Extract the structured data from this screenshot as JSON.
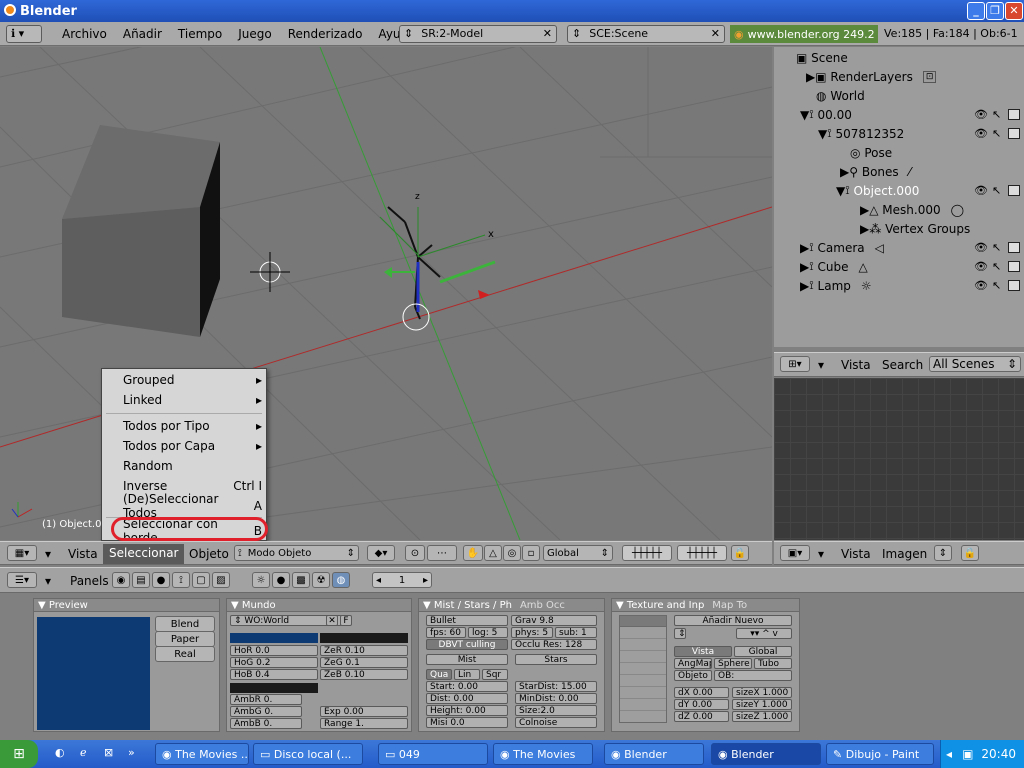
{
  "window": {
    "title": "Blender"
  },
  "menubar": {
    "items": [
      "Archivo",
      "Añadir",
      "Tiempo",
      "Juego",
      "Renderizado",
      "Ayuda"
    ],
    "screen": "SR:2-Model",
    "scene": "SCE:Scene",
    "version": "www.blender.org 249.2",
    "stats": "Ve:185 | Fa:184 | Ob:6-1"
  },
  "viewport": {
    "object_label": "(1) Object.0",
    "axis_labels": {
      "z": "z",
      "x": "x",
      "y": "y"
    }
  },
  "select_menu": {
    "items": [
      {
        "label": "Grouped",
        "shortcut": "▸"
      },
      {
        "label": "Linked",
        "shortcut": "▸"
      },
      {
        "label": "Todos por Tipo",
        "shortcut": "▸"
      },
      {
        "label": "Todos por Capa",
        "shortcut": "▸"
      },
      {
        "label": "Random",
        "shortcut": ""
      },
      {
        "label": "Inverse",
        "shortcut": "Ctrl I"
      },
      {
        "label": "(De)Seleccionar Todos",
        "shortcut": "A"
      },
      {
        "label": "Seleccionar con borde",
        "shortcut": "B"
      }
    ],
    "highlight_color": "#e0202a"
  },
  "view3d_header": {
    "vista": "Vista",
    "seleccionar": "Seleccionar",
    "objeto": "Objeto",
    "mode": "Modo Objeto",
    "orientation": "Global"
  },
  "outliner": {
    "items": [
      {
        "label": "Scene",
        "icon": "scene-icon"
      },
      {
        "label": "RenderLayers",
        "icon": "renderlayer-icon"
      },
      {
        "label": "World",
        "icon": "world-icon"
      },
      {
        "label": "00.00",
        "icon": "armature-icon"
      },
      {
        "label": "507812352",
        "icon": "armature-icon"
      },
      {
        "label": "Pose",
        "icon": "pose-icon"
      },
      {
        "label": "Bones",
        "icon": "bone-icon"
      },
      {
        "label": "Object.000",
        "icon": "armature-icon"
      },
      {
        "label": "Mesh.000",
        "icon": "mesh-icon"
      },
      {
        "label": "Vertex Groups",
        "icon": "vertexgroup-icon"
      },
      {
        "label": "Camera",
        "icon": "camera-icon"
      },
      {
        "label": "Cube",
        "icon": "mesh-icon"
      },
      {
        "label": "Lamp",
        "icon": "lamp-icon"
      }
    ],
    "header": {
      "vista": "Vista",
      "search": "Search",
      "scope": "All Scenes"
    }
  },
  "image_header": {
    "vista": "Vista",
    "imagen": "Imagen"
  },
  "buttons_header": {
    "panels": "Panels",
    "frame": "1"
  },
  "panels": {
    "preview": {
      "title": "Preview",
      "buttons": [
        "Blend",
        "Paper",
        "Real"
      ],
      "sky_color": "#0d3a73"
    },
    "mundo": {
      "title": "Mundo",
      "world_name": "WO:World",
      "fields_left": [
        "HoR 0.0",
        "HoG 0.2",
        "HoB 0.4"
      ],
      "fields_right": [
        "ZeR 0.10",
        "ZeG 0.1",
        "ZeB 0.10"
      ],
      "amb": [
        "AmbR 0.",
        "AmbG 0.",
        "AmbB 0."
      ],
      "exp": "Exp 0.00",
      "range": "Range 1."
    },
    "mist": {
      "title": "Mist / Stars / Ph",
      "tab2": "Amb Occ",
      "physics": "Bullet",
      "grav": "Grav 9.8",
      "fps": "fps: 60",
      "log": "log: 5",
      "phys": "phys: 5",
      "sub": "sub: 1",
      "dbvt": "DBVT culling",
      "occlu": "Occlu Res: 128",
      "mist": "Mist",
      "stars": "Stars",
      "qua": "Qua",
      "lin": "Lin",
      "sqr": "Sqr",
      "start": "Start: 0.00",
      "dist": "Dist: 0.00",
      "height": "Height: 0.00",
      "misi": "Misi 0.0",
      "stardist": "StarDist: 15.00",
      "mindist": "MinDist: 0.00",
      "size": "Size:2.0",
      "colnoise": "Colnoise"
    },
    "texture": {
      "title": "Texture and Inp",
      "tab2": "Map To",
      "add_new": "Añadir Nuevo",
      "vista": "Vista",
      "global": "Global",
      "angmap": "AngMap",
      "sphere": "Sphere",
      "tube": "Tubo",
      "objeto": "Objeto",
      "ob": "OB:",
      "dx": "dX 0.00",
      "dy": "dY 0.00",
      "dz": "dZ 0.00",
      "sx": "sizeX 1.000",
      "sy": "sizeY 1.000",
      "sz": "sizeZ 1.000"
    }
  },
  "taskbar": {
    "tasks": [
      "The Movies ...",
      "Disco local (...",
      "049",
      "The Movies",
      "Blender",
      "Blender",
      "Dibujo - Paint"
    ],
    "clock": "20:40"
  }
}
